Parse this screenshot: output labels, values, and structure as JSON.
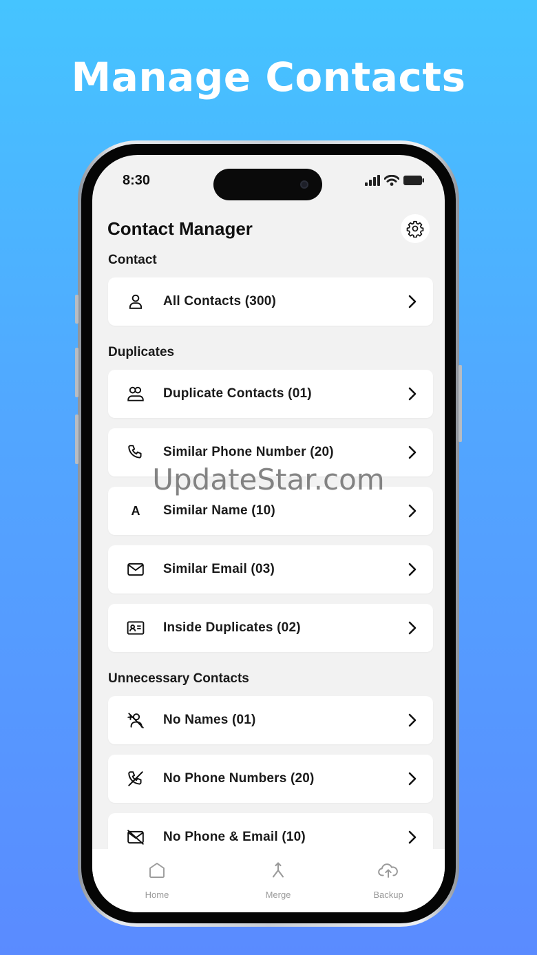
{
  "promo": {
    "headline": "Manage Contacts"
  },
  "status_bar": {
    "time": "8:30"
  },
  "app": {
    "title": "Contact Manager"
  },
  "sections": {
    "contact": {
      "label": "Contact",
      "items": [
        {
          "label": "All Contacts (300)",
          "icon": "person-icon"
        }
      ]
    },
    "duplicates": {
      "label": "Duplicates",
      "items": [
        {
          "label": "Duplicate Contacts (01)",
          "icon": "people-icon"
        },
        {
          "label": "Similar Phone Number (20)",
          "icon": "phone-icon"
        },
        {
          "label": "Similar Name (10)",
          "icon": "letter-a-icon",
          "glyph": "A"
        },
        {
          "label": "Similar Email (03)",
          "icon": "envelope-icon"
        },
        {
          "label": "Inside Duplicates (02)",
          "icon": "id-card-icon"
        }
      ]
    },
    "unnecessary": {
      "label": "Unnecessary Contacts",
      "items": [
        {
          "label": "No Names (01)",
          "icon": "person-slash-icon"
        },
        {
          "label": "No Phone Numbers (20)",
          "icon": "phone-slash-icon"
        },
        {
          "label": "No Phone & Email (10)",
          "icon": "envelope-slash-icon"
        }
      ]
    }
  },
  "tabbar": {
    "items": [
      {
        "label": "Home",
        "icon": "home-icon"
      },
      {
        "label": "Merge",
        "icon": "merge-icon"
      },
      {
        "label": "Backup",
        "icon": "cloud-upload-icon"
      }
    ]
  },
  "watermark": {
    "text": "UpdateStar.com"
  },
  "colors": {
    "background_top": "#45c4ff",
    "background_bottom": "#5a8bff",
    "screen": "#f2f2f2",
    "row": "#ffffff"
  }
}
